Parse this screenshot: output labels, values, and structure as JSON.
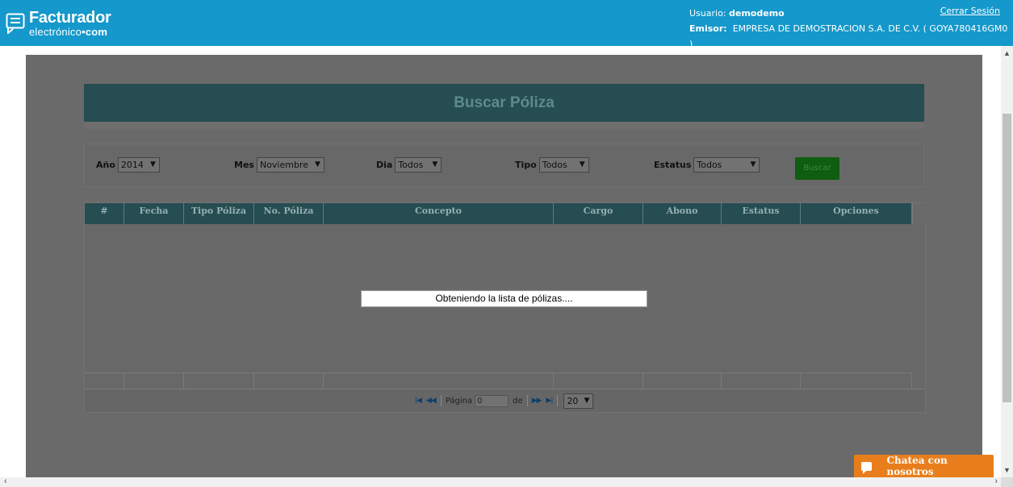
{
  "header": {
    "logo_main": "Facturador",
    "logo_sub_prefix": "electrónico",
    "logo_sub_dot": "•",
    "logo_sub_suffix": "com",
    "user_label": "Usuario:",
    "user_value": "demodemo",
    "emisor_label": "Emisor:",
    "emisor_value": "EMPRESA DE DEMOSTRACION S.A. DE C.V. ( GOYA780416GM0 )",
    "logout": "Cerrar Sesión",
    "color": "#1598cb"
  },
  "page": {
    "title": "Buscar Póliza"
  },
  "filters": {
    "anio_label": "Año",
    "anio_value": "2014",
    "mes_label": "Mes",
    "mes_value": "Noviembre",
    "dia_label": "Dia",
    "dia_value": "Todos",
    "tipo_label": "Tipo",
    "tipo_value": "Todos",
    "estatus_label": "Estatus",
    "estatus_value": "Todos",
    "buscar": "Buscar"
  },
  "table": {
    "columns": [
      "#",
      "Fecha",
      "Tipo Póliza",
      "No. Póliza",
      "Concepto",
      "Cargo",
      "Abono",
      "Estatus",
      "Opciones"
    ]
  },
  "pager": {
    "page_label": "Página",
    "page_value": "0",
    "of_label": "de",
    "page_size": "20"
  },
  "loading_message": "Obteniendo la lista de pólizas....",
  "chat": {
    "label": "Chatea con nosotros",
    "color": "#e87e1b"
  },
  "icons": [
    "invoice-logo-icon",
    "chevron-down-icon",
    "first-page-icon",
    "prev-page-icon",
    "next-page-icon",
    "last-page-icon",
    "chat-bubble-icon",
    "scroll-up-icon",
    "scroll-down-icon",
    "scroll-left-icon",
    "scroll-right-icon"
  ]
}
